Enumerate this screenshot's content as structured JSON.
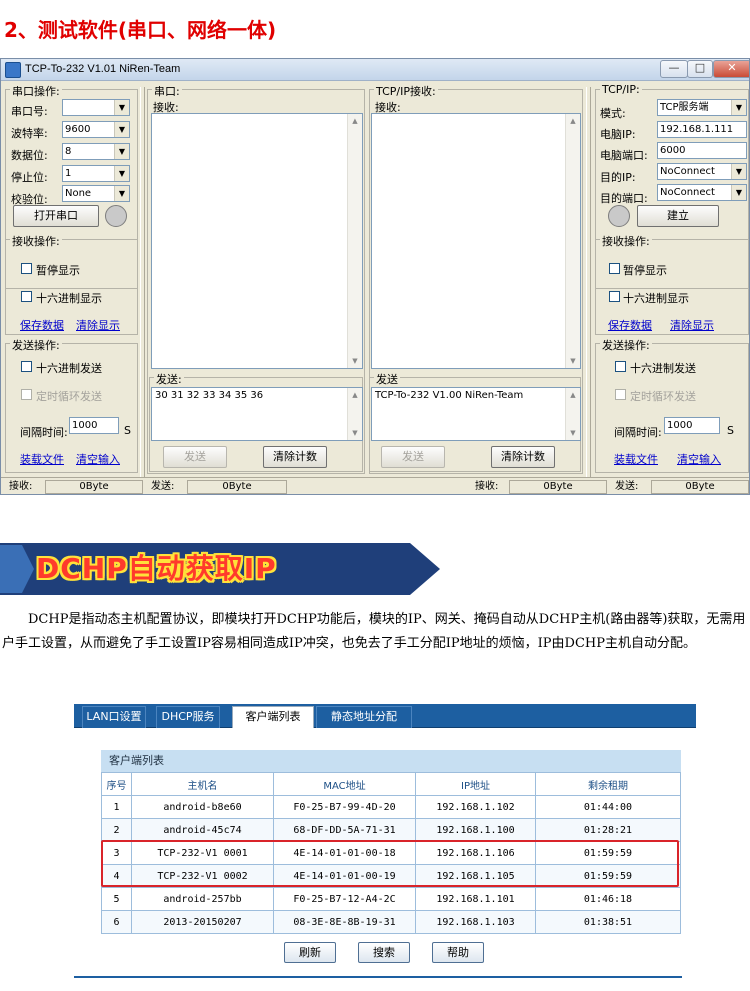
{
  "heading": "2、测试软件(串口、网络一体)",
  "app": {
    "title": "TCP-To-232 V1.01  NiRen-Team",
    "caption_buttons": {
      "minimize": "—",
      "maximize": "□",
      "close": "✕"
    }
  },
  "serial_ops": {
    "title": "串口操作:",
    "port_label": "串口号:",
    "port_value": "",
    "baud_label": "波特率:",
    "baud_value": "9600",
    "data_label": "数据位:",
    "data_value": "8",
    "stop_label": "停止位:",
    "stop_value": "1",
    "parity_label": "校验位:",
    "parity_value": "None",
    "open_button": "打开串口"
  },
  "recv_ops_left": {
    "title": "接收操作:",
    "pause": "暂停显示",
    "hex_display": "十六进制显示",
    "save_link": "保存数据",
    "clear_link": "清除显示"
  },
  "send_ops_left": {
    "title": "发送操作:",
    "hex_send": "十六进制发送",
    "timed_loop": "定时循环发送",
    "interval_label": "间隔时间:",
    "interval_value": "1000",
    "interval_unit": "S",
    "load_link": "装载文件",
    "clear_input_link": "清空输入"
  },
  "serial_panel": {
    "title": "串口:",
    "recv_label": "接收:",
    "send_title": "发送:",
    "send_text": "30 31 32 33 34 35 36",
    "send_button": "发送",
    "clear_count_button": "清除计数"
  },
  "tcp_panel": {
    "title": "TCP/IP接收:",
    "recv_label": "接收:",
    "send_title": "发送",
    "send_text": "TCP-To-232 V1.00  NiRen-Team",
    "send_button": "发送",
    "clear_count_button": "清除计数"
  },
  "tcpip_ops": {
    "title": "TCP/IP:",
    "mode_label": "模式:",
    "mode_value": "TCP服务端",
    "ip_label": "电脑IP:",
    "ip_value": "192.168.1.111",
    "port_label": "电脑端口:",
    "port_value": "6000",
    "target_ip_label": "目的IP:",
    "target_ip_value": "NoConnect",
    "target_port_label": "目的端口:",
    "target_port_value": "NoConnect",
    "build_button": "建立"
  },
  "recv_ops_right": {
    "title": "接收操作:",
    "pause": "暂停显示",
    "hex_display": "十六进制显示",
    "save_link": "保存数据",
    "clear_link": "清除显示"
  },
  "send_ops_right": {
    "title": "发送操作:",
    "hex_send": "十六进制发送",
    "timed_loop": "定时循环发送",
    "interval_label": "间隔时间:",
    "interval_value": "1000",
    "interval_unit": "S",
    "load_link": "装载文件",
    "clear_input_link": "清空输入"
  },
  "statusbar": {
    "recv1_label": "接收:",
    "recv1_value": "0Byte",
    "send1_label": "发送:",
    "send1_value": "0Byte",
    "recv2_label": "接收:",
    "recv2_value": "0Byte",
    "send2_label": "发送:",
    "send2_value": "0Byte"
  },
  "banner": {
    "text": "DCHP自动获取IP",
    "colors": {
      "text": "#ff3a2c",
      "outline": "#ffe23a",
      "band": "#1f3f7a"
    }
  },
  "paragraph": "DCHP是指动态主机配置协议，即模块打开DCHP功能后，模块的IP、网关、掩码自动从DCHP主机(路由器等)获取，无需用户手工设置，从而避免了手工设置IP容易相同造成IP冲突，也免去了手工分配IP地址的烦恼，IP由DCHP主机自动分配。",
  "router": {
    "tabs": [
      "LAN口设置",
      "DHCP服务",
      "客户端列表",
      "静态地址分配"
    ],
    "active_tab": "客户端列表",
    "list_title": "客户端列表",
    "columns": [
      "序号",
      "主机名",
      "MAC地址",
      "IP地址",
      "剩余租期"
    ],
    "rows": [
      [
        "1",
        "android-b8e60",
        "F0-25-B7-99-4D-20",
        "192.168.1.102",
        "01:44:00"
      ],
      [
        "2",
        "android-45c74",
        "68-DF-DD-5A-71-31",
        "192.168.1.100",
        "01:28:21"
      ],
      [
        "3",
        "TCP-232-V1 0001",
        "4E-14-01-01-00-18",
        "192.168.1.106",
        "01:59:59"
      ],
      [
        "4",
        "TCP-232-V1 0002",
        "4E-14-01-01-00-19",
        "192.168.1.105",
        "01:59:59"
      ],
      [
        "5",
        "android-257bb",
        "F0-25-B7-12-A4-2C",
        "192.168.1.101",
        "01:46:18"
      ],
      [
        "6",
        "2013-20150207",
        "08-3E-8E-8B-19-31",
        "192.168.1.103",
        "01:38:51"
      ]
    ],
    "buttons": {
      "refresh": "刷新",
      "search": "搜索",
      "help": "帮助"
    },
    "highlight_color": "#d9242a"
  }
}
